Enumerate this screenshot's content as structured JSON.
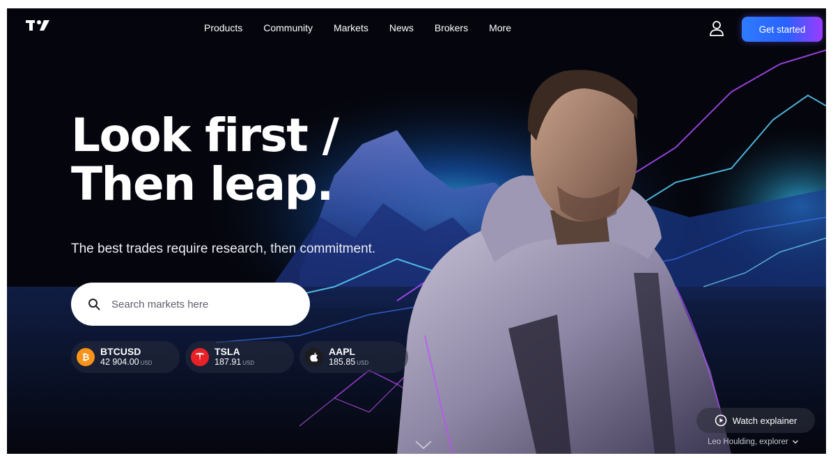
{
  "header": {
    "logo": "tradingview-logo-icon",
    "nav": [
      "Products",
      "Community",
      "Markets",
      "News",
      "Brokers",
      "More"
    ],
    "user_icon": "user-icon",
    "cta_label": "Get started"
  },
  "hero": {
    "headline_line1": "Look first /",
    "headline_line2": "Then leap.",
    "subline": "The best trades require research, then commitment."
  },
  "search": {
    "placeholder": "Search markets here",
    "icon": "search-icon"
  },
  "tickers": [
    {
      "symbol": "BTCUSD",
      "price": "42 904.00",
      "currency": "USD",
      "icon": "bitcoin-icon",
      "color": "#f7931a"
    },
    {
      "symbol": "TSLA",
      "price": "187.91",
      "currency": "USD",
      "icon": "tesla-icon",
      "color": "#e82127"
    },
    {
      "symbol": "AAPL",
      "price": "185.85",
      "currency": "USD",
      "icon": "apple-icon",
      "color": "#1c1c1e"
    }
  ],
  "watch": {
    "label": "Watch explainer",
    "icon": "play-icon"
  },
  "credit": "Leo Houlding, explorer",
  "colors": {
    "background": "#05060d",
    "accent_blue": "#2962ff",
    "accent_purple": "#9b3bff",
    "glow_cyan": "#2ec8ff"
  }
}
